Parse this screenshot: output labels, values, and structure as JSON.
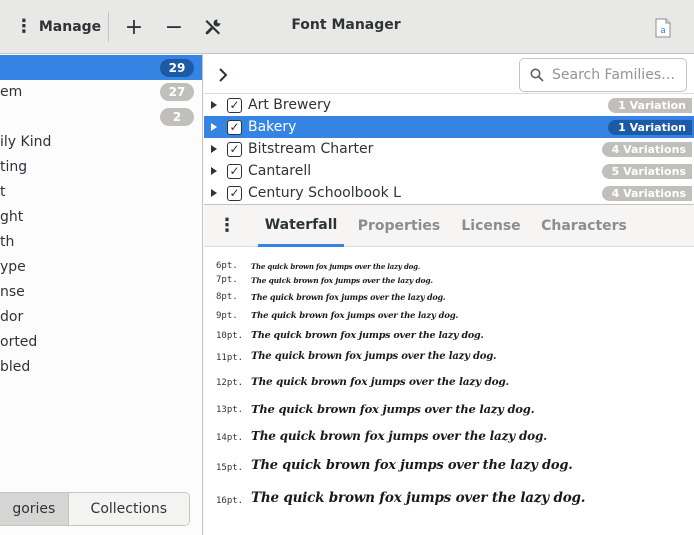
{
  "header": {
    "manage_label": "Manage",
    "add_label": "+",
    "remove_label": "−",
    "title": "Font Manager"
  },
  "sidebar": {
    "items": [
      {
        "label": "",
        "count": "29",
        "selected": true
      },
      {
        "label": "em",
        "count": "27"
      },
      {
        "label": "",
        "count": "2"
      },
      {
        "label": "ily Kind"
      },
      {
        "label": "ting"
      },
      {
        "label": "t"
      },
      {
        "label": "ght"
      },
      {
        "label": "th"
      },
      {
        "label": "ype"
      },
      {
        "label": "nse"
      },
      {
        "label": "dor"
      },
      {
        "label": "orted"
      },
      {
        "label": "bled"
      }
    ],
    "switcher": {
      "categories": "gories",
      "collections": "Collections"
    }
  },
  "search": {
    "placeholder": "Search Families…"
  },
  "fonts": [
    {
      "name": "Art Brewery",
      "variations": "1 Variation"
    },
    {
      "name": "Bakery",
      "variations": "1 Variation",
      "selected": true
    },
    {
      "name": "Bitstream Charter",
      "variations": "4 Variations"
    },
    {
      "name": "Cantarell",
      "variations": "5 Variations"
    },
    {
      "name": "Century Schoolbook L",
      "variations": "4 Variations"
    }
  ],
  "tabs": [
    "Waterfall",
    "Properties",
    "License",
    "Characters"
  ],
  "waterfall": {
    "sample": "The quick brown fox jumps over the lazy dog.",
    "sizes": [
      "6pt.",
      "7pt.",
      "8pt.",
      "9pt.",
      "10pt.",
      "11pt.",
      "12pt.",
      "13pt.",
      "14pt.",
      "15pt.",
      "16pt."
    ]
  },
  "colors": {
    "accent": "#3584e4",
    "badge": "#c0bfbc",
    "badge_selected": "#1c5aa6"
  }
}
